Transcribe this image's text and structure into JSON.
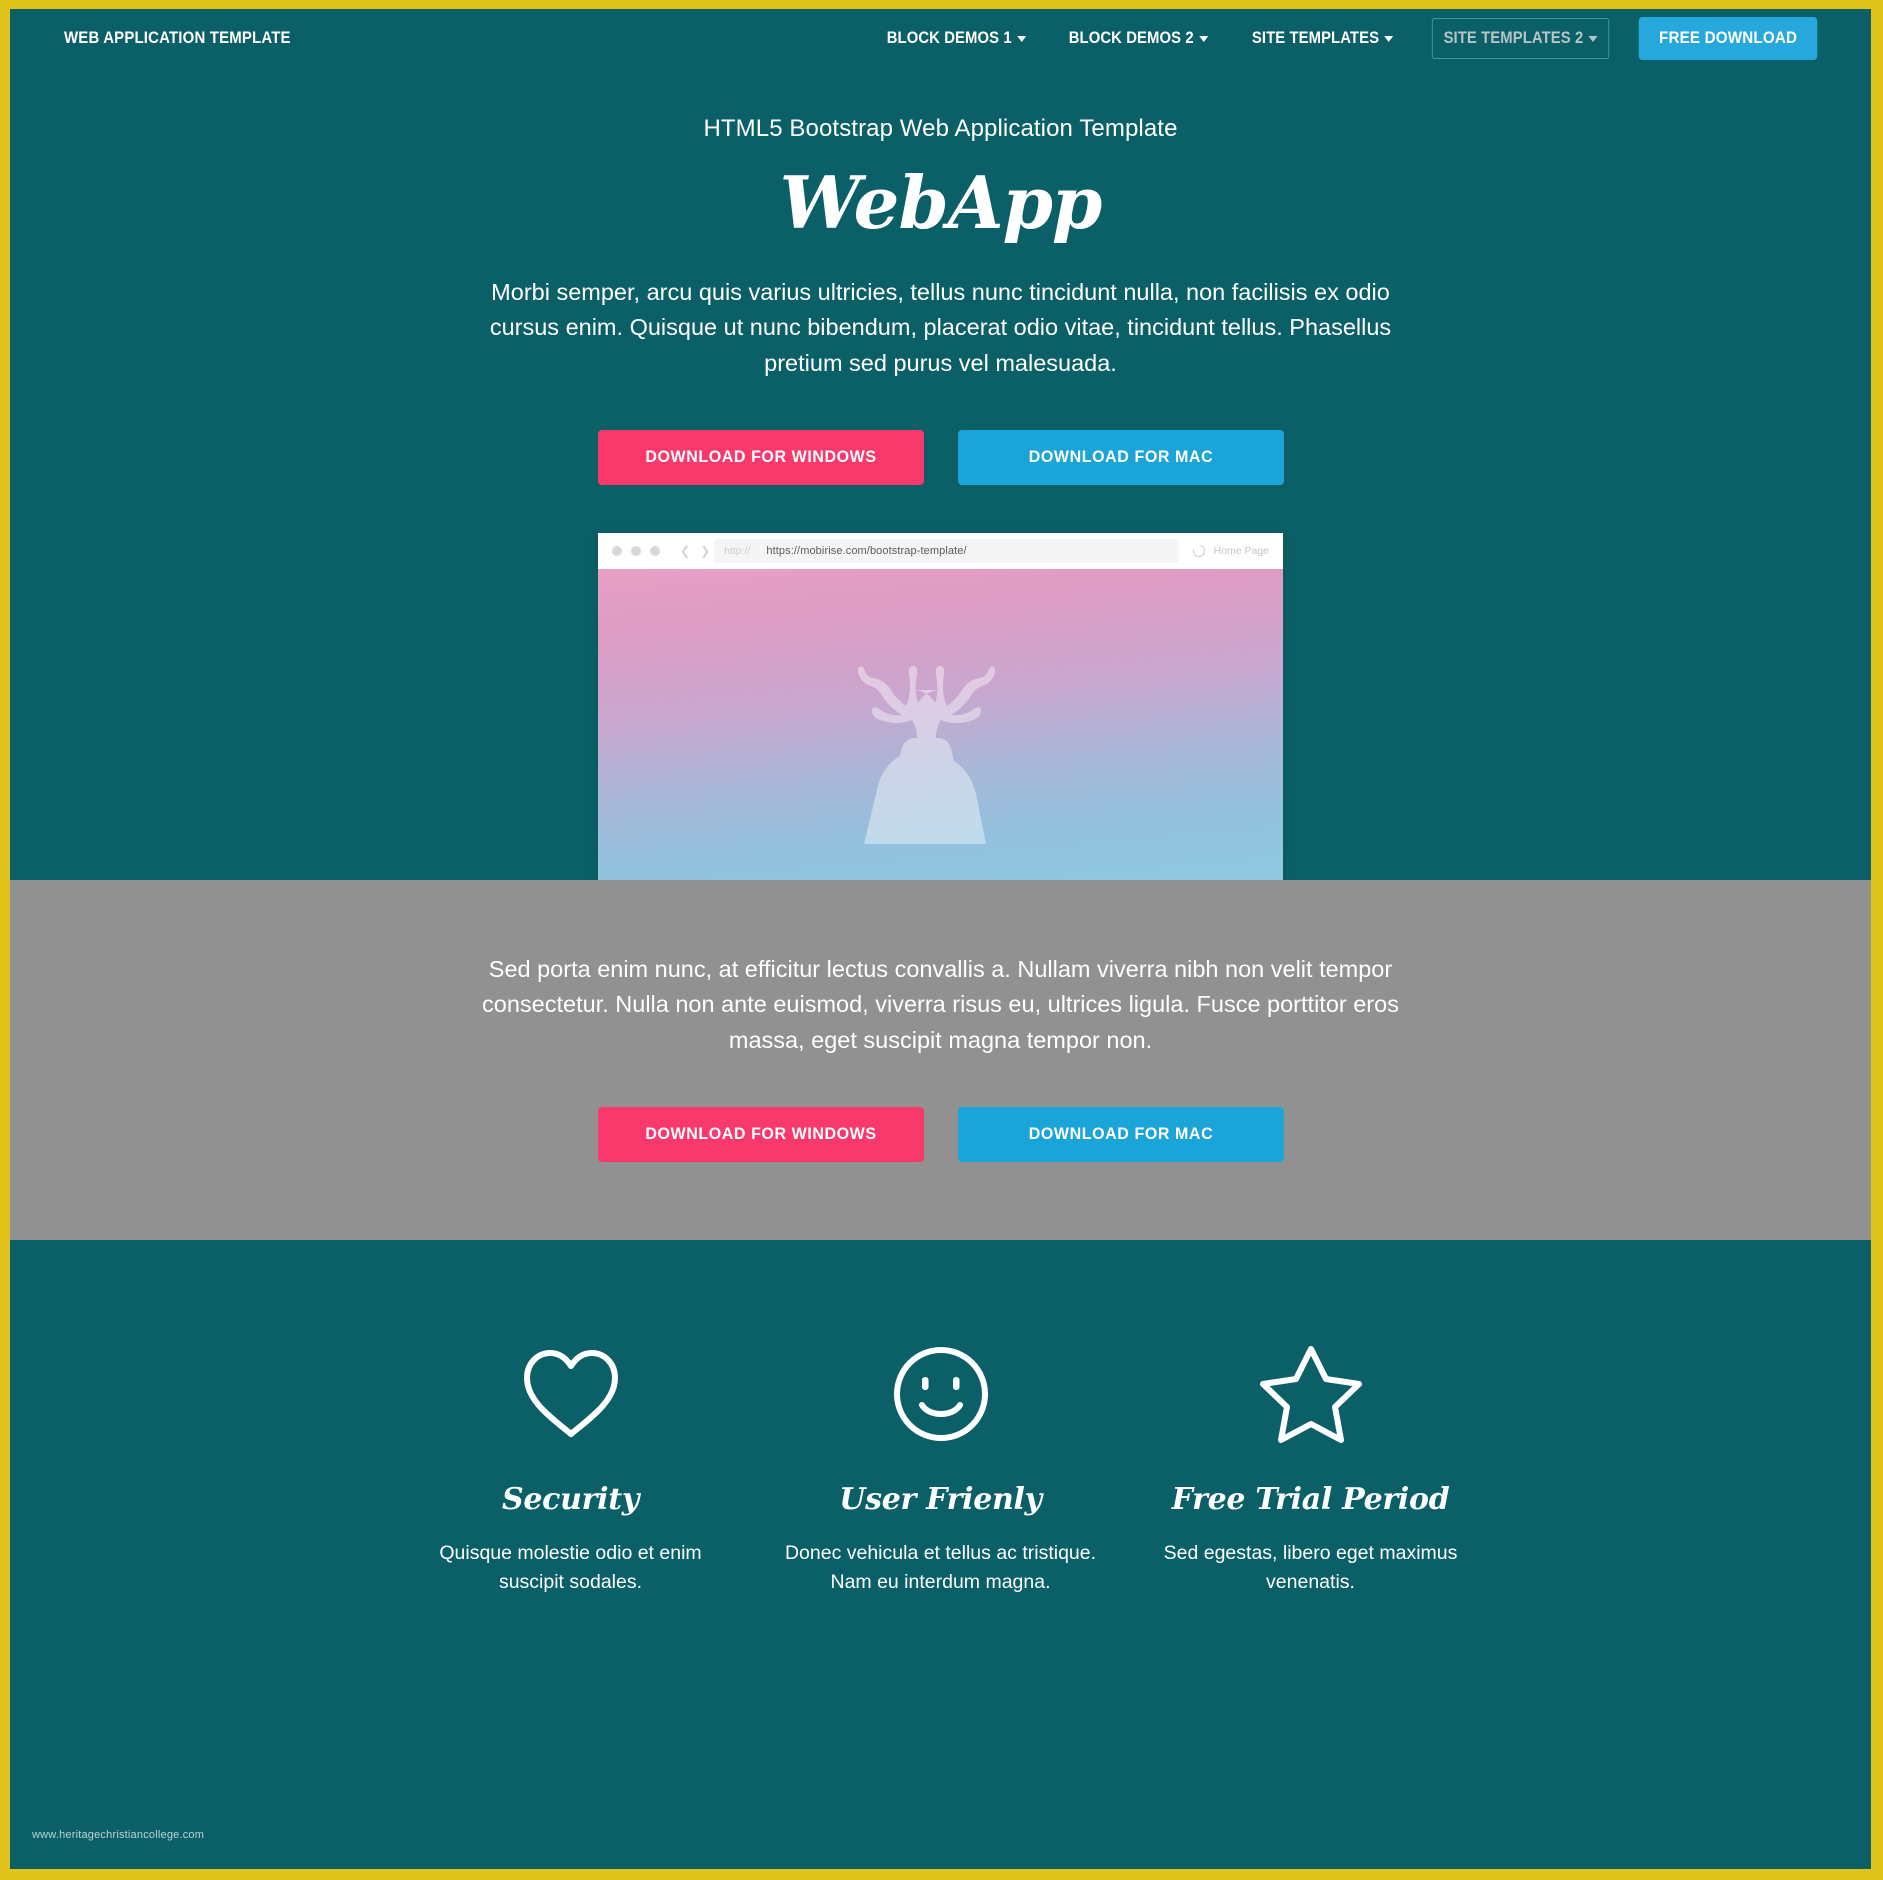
{
  "theme": {
    "frame_border": "#e0c41c",
    "teal": "#0b6068",
    "gray": "#919191",
    "pink": "#f9386b",
    "blue": "#1ba4d8",
    "nav_button_blue": "#27a8dd"
  },
  "navbar": {
    "brand": "WEB APPLICATION TEMPLATE",
    "items": [
      {
        "label": "BLOCK DEMOS 1",
        "has_caret": true,
        "focused": false
      },
      {
        "label": "BLOCK DEMOS 2",
        "has_caret": true,
        "focused": false
      },
      {
        "label": "SITE TEMPLATES",
        "has_caret": true,
        "focused": false
      },
      {
        "label": "SITE TEMPLATES 2",
        "has_caret": true,
        "focused": true
      }
    ],
    "cta_label": "FREE DOWNLOAD"
  },
  "hero": {
    "kicker": "HTML5 Bootstrap Web Application Template",
    "title": "WebApp",
    "paragraph": "Morbi semper, arcu quis varius ultricies, tellus nunc tincidunt nulla, non facilisis ex odio cursus enim. Quisque ut nunc bibendum, placerat odio vitae, tincidunt tellus. Phasellus pretium sed purus vel malesuada.",
    "btn_windows": "DOWNLOAD FOR WINDOWS",
    "btn_mac": "DOWNLOAD FOR MAC"
  },
  "browser_mockup": {
    "url_placeholder": "http://",
    "url_value": "https://mobirise.com/bootstrap-template/",
    "home_label": "Home Page",
    "image_subject": "deer-silhouette"
  },
  "gray_section": {
    "paragraph": "Sed porta enim nunc, at efficitur lectus convallis a. Nullam viverra nibh non velit tempor consectetur. Nulla non ante euismod, viverra risus eu, ultrices ligula. Fusce porttitor eros massa, eget suscipit magna tempor non.",
    "btn_windows": "DOWNLOAD FOR WINDOWS",
    "btn_mac": "DOWNLOAD FOR MAC"
  },
  "features": [
    {
      "icon": "heart-icon",
      "title": "Security",
      "text": "Quisque molestie odio et enim suscipit sodales."
    },
    {
      "icon": "smiley-icon",
      "title": "User Frienly",
      "text": "Donec vehicula et tellus ac tristique. Nam eu interdum magna."
    },
    {
      "icon": "star-icon",
      "title": "Free Trial Period",
      "text": "Sed egestas, libero eget maximus venenatis."
    }
  ],
  "footer": {
    "watermark": "www.heritagechristiancollege.com"
  }
}
